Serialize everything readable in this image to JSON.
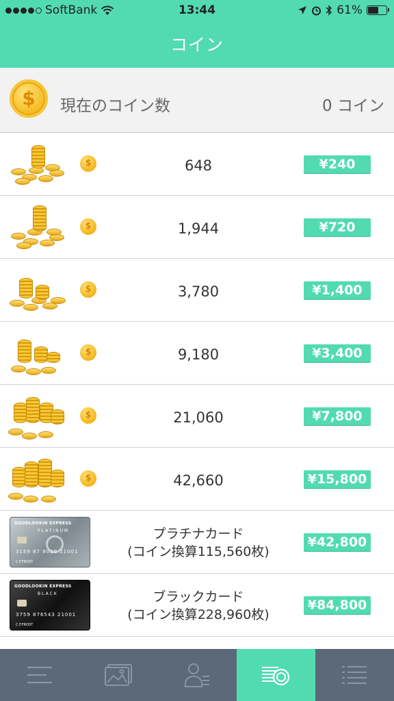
{
  "status_bar": {
    "carrier": "SoftBank",
    "time": "13:44",
    "battery": "61%",
    "battery_level": 0.61
  },
  "header": {
    "title": "コイン"
  },
  "summary": {
    "label": "現在のコイン数",
    "value": "0 コイン",
    "coin_symbol": "$"
  },
  "coin_symbol_small": "$",
  "packages": [
    {
      "amount": "648",
      "price": "¥240"
    },
    {
      "amount": "1,944",
      "price": "¥720"
    },
    {
      "amount": "3,780",
      "price": "¥1,400"
    },
    {
      "amount": "9,180",
      "price": "¥3,400"
    },
    {
      "amount": "21,060",
      "price": "¥7,800"
    },
    {
      "amount": "42,660",
      "price": "¥15,800"
    }
  ],
  "cards": [
    {
      "title": "プラチナカード",
      "subtitle": "(コイン換算115,560枚)",
      "price": "¥42,800",
      "brand": "GOODLOOKIN EXPRESS",
      "tier": "PLATINUM",
      "number": "3159 87 9020 21001",
      "holder": "C.F.FROST"
    },
    {
      "title": "ブラックカード",
      "subtitle": "(コイン換算228,960枚)",
      "price": "¥84,800",
      "brand": "GOODLOOKIN EXPRESS",
      "tier": "BLACK",
      "number": "3759 876543 21001",
      "holder": "C.F.FROST"
    }
  ],
  "tabs": [
    {
      "icon": "menu-icon",
      "active": false
    },
    {
      "icon": "photos-icon",
      "active": false
    },
    {
      "icon": "profile-icon",
      "active": false
    },
    {
      "icon": "coins-icon",
      "active": true
    },
    {
      "icon": "list-icon",
      "active": false
    }
  ],
  "colors": {
    "accent": "#52dbb0",
    "tabbar": "#5b6978"
  }
}
